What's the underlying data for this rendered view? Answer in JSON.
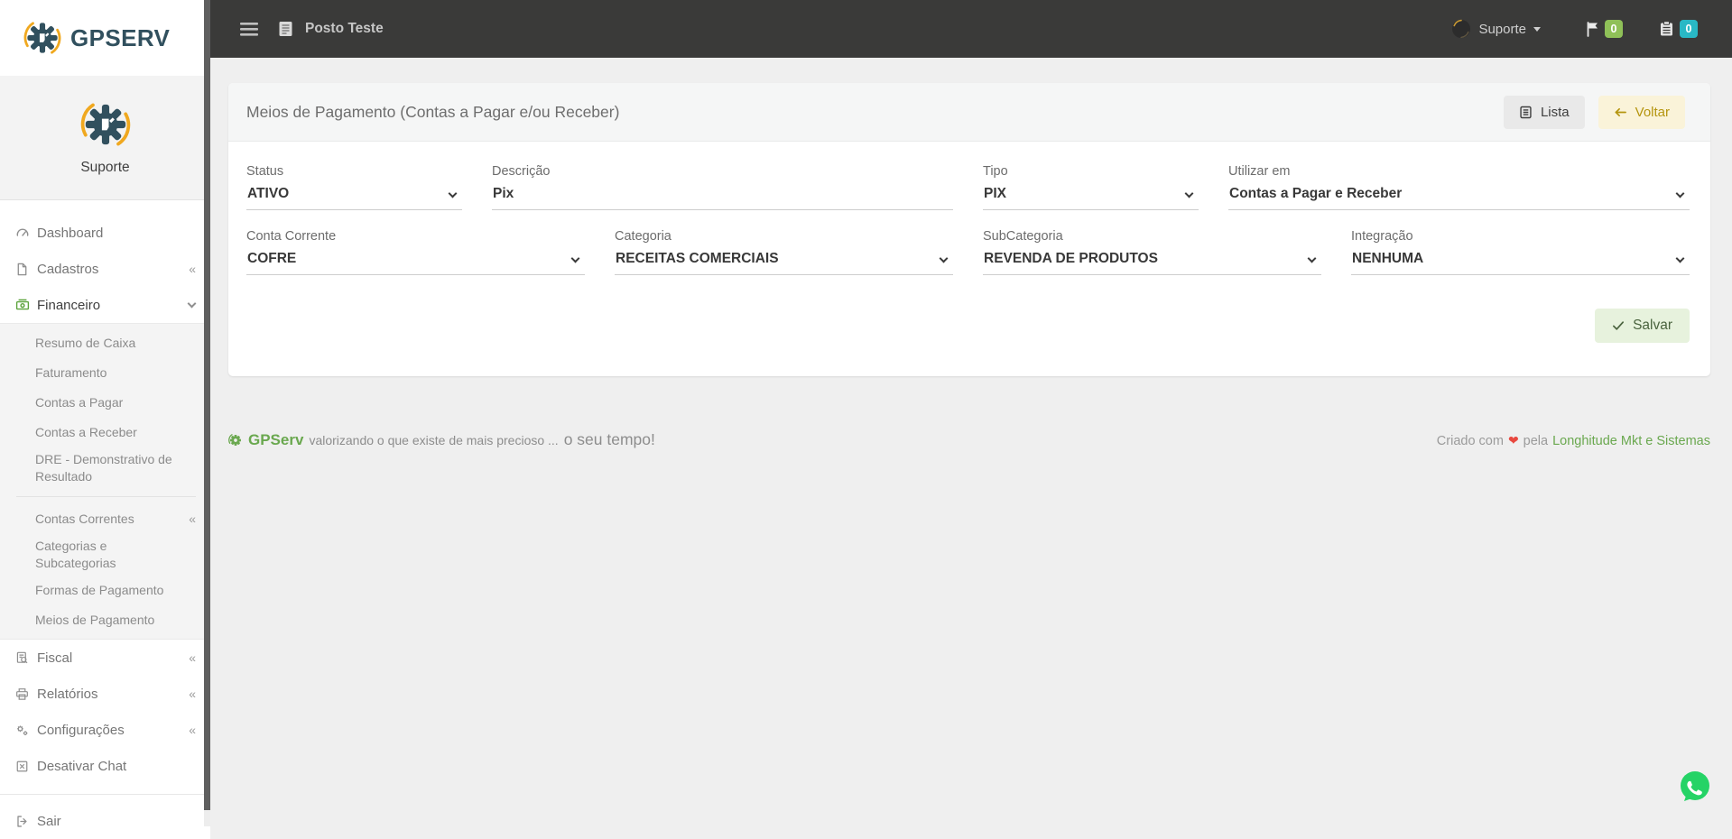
{
  "colors": {
    "brand_dark": "#31505e",
    "brand_yellow": "#f0a81f",
    "brand_green": "#6aa84f",
    "navbar_bg": "#3a3a39",
    "badge_green": "#8fc058",
    "badge_teal": "#29b8c5",
    "voltar_bg": "#faf3d9",
    "voltar_text": "#b5950f",
    "salvar_bg": "#e7f2dd",
    "salvar_text": "#4a633e",
    "whatsapp_green": "#25d366",
    "heart_red": "#e8483f"
  },
  "navbar": {
    "company": "Posto Teste",
    "user_label": "Suporte",
    "flag_count": "0",
    "calendar_count": "0"
  },
  "sidebar": {
    "logo_text": "GPSERV",
    "profile_name": "Suporte",
    "menu": [
      {
        "label": "Dashboard"
      },
      {
        "label": "Cadastros",
        "collapse_glyph": "«"
      },
      {
        "label": "Financeiro",
        "expanded": true
      },
      {
        "label": "Fiscal",
        "collapse_glyph": "«"
      },
      {
        "label": "Relatórios",
        "collapse_glyph": "«"
      },
      {
        "label": "Configurações",
        "collapse_glyph": "«"
      },
      {
        "label": "Desativar Chat"
      },
      {
        "label": "Sair"
      }
    ],
    "financeiro_submenu": [
      {
        "label": "Resumo de Caixa"
      },
      {
        "label": "Faturamento"
      },
      {
        "label": "Contas a Pagar"
      },
      {
        "label": "Contas a Receber"
      },
      {
        "label": "DRE - Demonstrativo de Resultado"
      },
      {
        "label": "Contas Correntes",
        "collapse_glyph": "«"
      },
      {
        "label": "Categorias e Subcategorias"
      },
      {
        "label": "Formas de Pagamento"
      },
      {
        "label": "Meios de Pagamento"
      }
    ]
  },
  "card": {
    "title": "Meios de Pagamento (Contas a Pagar e/ou Receber)",
    "lista_button": "Lista",
    "voltar_button": "Voltar",
    "salvar_button": "Salvar"
  },
  "form": {
    "fields": [
      {
        "label": "Status",
        "value": "ATIVO",
        "type": "select"
      },
      {
        "label": "Descrição",
        "value": "Pix",
        "type": "text"
      },
      {
        "label": "Tipo",
        "value": "PIX",
        "type": "select"
      },
      {
        "label": "Utilizar em",
        "value": "Contas a Pagar e Receber",
        "type": "select"
      },
      {
        "label": "Conta Corrente",
        "value": "COFRE",
        "type": "select"
      },
      {
        "label": "Categoria",
        "value": "RECEITAS COMERCIAIS",
        "type": "select"
      },
      {
        "label": "SubCategoria",
        "value": "REVENDA DE PRODUTOS",
        "type": "select"
      },
      {
        "label": "Integração",
        "value": "NENHUMA",
        "type": "select"
      }
    ]
  },
  "footer": {
    "brand": "GPServ",
    "tagline": "valorizando o que existe de mais precioso ... ",
    "tagline_emphasis": "o seu tempo!",
    "credit_prefix": "Criado com",
    "credit_heart": "❤",
    "credit_middle": "pela",
    "credit_link": "Longhitude Mkt e Sistemas"
  }
}
